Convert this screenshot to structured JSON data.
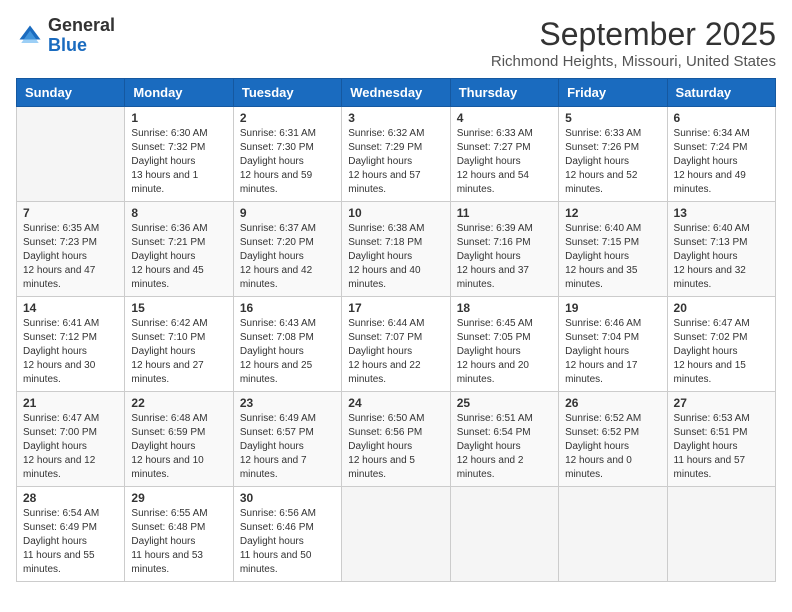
{
  "logo": {
    "general": "General",
    "blue": "Blue"
  },
  "title": "September 2025",
  "subtitle": "Richmond Heights, Missouri, United States",
  "days_of_week": [
    "Sunday",
    "Monday",
    "Tuesday",
    "Wednesday",
    "Thursday",
    "Friday",
    "Saturday"
  ],
  "weeks": [
    [
      {
        "day": null
      },
      {
        "day": "1",
        "sunrise": "Sunrise: 6:30 AM",
        "sunset": "Sunset: 7:32 PM",
        "daylight": "Daylight: 13 hours and 1 minute."
      },
      {
        "day": "2",
        "sunrise": "Sunrise: 6:31 AM",
        "sunset": "Sunset: 7:30 PM",
        "daylight": "Daylight: 12 hours and 59 minutes."
      },
      {
        "day": "3",
        "sunrise": "Sunrise: 6:32 AM",
        "sunset": "Sunset: 7:29 PM",
        "daylight": "Daylight: 12 hours and 57 minutes."
      },
      {
        "day": "4",
        "sunrise": "Sunrise: 6:33 AM",
        "sunset": "Sunset: 7:27 PM",
        "daylight": "Daylight: 12 hours and 54 minutes."
      },
      {
        "day": "5",
        "sunrise": "Sunrise: 6:33 AM",
        "sunset": "Sunset: 7:26 PM",
        "daylight": "Daylight: 12 hours and 52 minutes."
      },
      {
        "day": "6",
        "sunrise": "Sunrise: 6:34 AM",
        "sunset": "Sunset: 7:24 PM",
        "daylight": "Daylight: 12 hours and 49 minutes."
      }
    ],
    [
      {
        "day": "7",
        "sunrise": "Sunrise: 6:35 AM",
        "sunset": "Sunset: 7:23 PM",
        "daylight": "Daylight: 12 hours and 47 minutes."
      },
      {
        "day": "8",
        "sunrise": "Sunrise: 6:36 AM",
        "sunset": "Sunset: 7:21 PM",
        "daylight": "Daylight: 12 hours and 45 minutes."
      },
      {
        "day": "9",
        "sunrise": "Sunrise: 6:37 AM",
        "sunset": "Sunset: 7:20 PM",
        "daylight": "Daylight: 12 hours and 42 minutes."
      },
      {
        "day": "10",
        "sunrise": "Sunrise: 6:38 AM",
        "sunset": "Sunset: 7:18 PM",
        "daylight": "Daylight: 12 hours and 40 minutes."
      },
      {
        "day": "11",
        "sunrise": "Sunrise: 6:39 AM",
        "sunset": "Sunset: 7:16 PM",
        "daylight": "Daylight: 12 hours and 37 minutes."
      },
      {
        "day": "12",
        "sunrise": "Sunrise: 6:40 AM",
        "sunset": "Sunset: 7:15 PM",
        "daylight": "Daylight: 12 hours and 35 minutes."
      },
      {
        "day": "13",
        "sunrise": "Sunrise: 6:40 AM",
        "sunset": "Sunset: 7:13 PM",
        "daylight": "Daylight: 12 hours and 32 minutes."
      }
    ],
    [
      {
        "day": "14",
        "sunrise": "Sunrise: 6:41 AM",
        "sunset": "Sunset: 7:12 PM",
        "daylight": "Daylight: 12 hours and 30 minutes."
      },
      {
        "day": "15",
        "sunrise": "Sunrise: 6:42 AM",
        "sunset": "Sunset: 7:10 PM",
        "daylight": "Daylight: 12 hours and 27 minutes."
      },
      {
        "day": "16",
        "sunrise": "Sunrise: 6:43 AM",
        "sunset": "Sunset: 7:08 PM",
        "daylight": "Daylight: 12 hours and 25 minutes."
      },
      {
        "day": "17",
        "sunrise": "Sunrise: 6:44 AM",
        "sunset": "Sunset: 7:07 PM",
        "daylight": "Daylight: 12 hours and 22 minutes."
      },
      {
        "day": "18",
        "sunrise": "Sunrise: 6:45 AM",
        "sunset": "Sunset: 7:05 PM",
        "daylight": "Daylight: 12 hours and 20 minutes."
      },
      {
        "day": "19",
        "sunrise": "Sunrise: 6:46 AM",
        "sunset": "Sunset: 7:04 PM",
        "daylight": "Daylight: 12 hours and 17 minutes."
      },
      {
        "day": "20",
        "sunrise": "Sunrise: 6:47 AM",
        "sunset": "Sunset: 7:02 PM",
        "daylight": "Daylight: 12 hours and 15 minutes."
      }
    ],
    [
      {
        "day": "21",
        "sunrise": "Sunrise: 6:47 AM",
        "sunset": "Sunset: 7:00 PM",
        "daylight": "Daylight: 12 hours and 12 minutes."
      },
      {
        "day": "22",
        "sunrise": "Sunrise: 6:48 AM",
        "sunset": "Sunset: 6:59 PM",
        "daylight": "Daylight: 12 hours and 10 minutes."
      },
      {
        "day": "23",
        "sunrise": "Sunrise: 6:49 AM",
        "sunset": "Sunset: 6:57 PM",
        "daylight": "Daylight: 12 hours and 7 minutes."
      },
      {
        "day": "24",
        "sunrise": "Sunrise: 6:50 AM",
        "sunset": "Sunset: 6:56 PM",
        "daylight": "Daylight: 12 hours and 5 minutes."
      },
      {
        "day": "25",
        "sunrise": "Sunrise: 6:51 AM",
        "sunset": "Sunset: 6:54 PM",
        "daylight": "Daylight: 12 hours and 2 minutes."
      },
      {
        "day": "26",
        "sunrise": "Sunrise: 6:52 AM",
        "sunset": "Sunset: 6:52 PM",
        "daylight": "Daylight: 12 hours and 0 minutes."
      },
      {
        "day": "27",
        "sunrise": "Sunrise: 6:53 AM",
        "sunset": "Sunset: 6:51 PM",
        "daylight": "Daylight: 11 hours and 57 minutes."
      }
    ],
    [
      {
        "day": "28",
        "sunrise": "Sunrise: 6:54 AM",
        "sunset": "Sunset: 6:49 PM",
        "daylight": "Daylight: 11 hours and 55 minutes."
      },
      {
        "day": "29",
        "sunrise": "Sunrise: 6:55 AM",
        "sunset": "Sunset: 6:48 PM",
        "daylight": "Daylight: 11 hours and 53 minutes."
      },
      {
        "day": "30",
        "sunrise": "Sunrise: 6:56 AM",
        "sunset": "Sunset: 6:46 PM",
        "daylight": "Daylight: 11 hours and 50 minutes."
      },
      {
        "day": null
      },
      {
        "day": null
      },
      {
        "day": null
      },
      {
        "day": null
      }
    ]
  ]
}
